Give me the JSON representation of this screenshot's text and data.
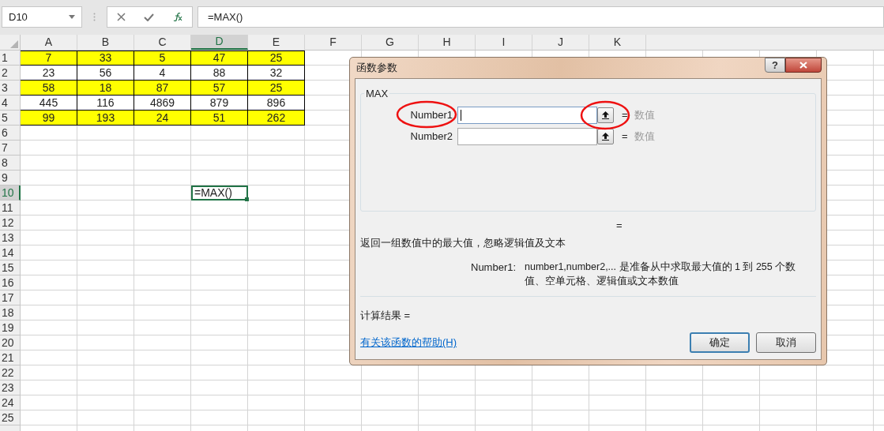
{
  "formula_bar": {
    "name_box": "D10",
    "formula": "=MAX()"
  },
  "sheet": {
    "columns": [
      {
        "label": "A",
        "selected": false
      },
      {
        "label": "B",
        "selected": false
      },
      {
        "label": "C",
        "selected": false
      },
      {
        "label": "D",
        "selected": true
      },
      {
        "label": "E",
        "selected": false
      },
      {
        "label": "F",
        "selected": false
      },
      {
        "label": "G",
        "selected": false
      },
      {
        "label": "H",
        "selected": false
      },
      {
        "label": "I",
        "selected": false
      },
      {
        "label": "J",
        "selected": false
      },
      {
        "label": "K",
        "selected": false
      }
    ],
    "rows": [
      {
        "label": "1",
        "selected": false,
        "highlighted": true,
        "cells": [
          {
            "text": "7",
            "selected": false
          },
          {
            "text": "33",
            "selected": false
          },
          {
            "text": "5",
            "selected": false
          },
          {
            "text": "47",
            "selected": false
          },
          {
            "text": "25",
            "selected": false
          }
        ]
      },
      {
        "label": "2",
        "selected": false,
        "highlighted": false,
        "cells": [
          {
            "text": "23",
            "selected": false
          },
          {
            "text": "56",
            "selected": false
          },
          {
            "text": "4",
            "selected": false
          },
          {
            "text": "88",
            "selected": false
          },
          {
            "text": "32",
            "selected": false
          }
        ]
      },
      {
        "label": "3",
        "selected": false,
        "highlighted": true,
        "cells": [
          {
            "text": "58",
            "selected": false
          },
          {
            "text": "18",
            "selected": false
          },
          {
            "text": "87",
            "selected": false
          },
          {
            "text": "57",
            "selected": false
          },
          {
            "text": "25",
            "selected": false
          }
        ]
      },
      {
        "label": "4",
        "selected": false,
        "highlighted": false,
        "cells": [
          {
            "text": "445",
            "selected": false
          },
          {
            "text": "116",
            "selected": false
          },
          {
            "text": "4869",
            "selected": false
          },
          {
            "text": "879",
            "selected": false
          },
          {
            "text": "896",
            "selected": false
          }
        ]
      },
      {
        "label": "5",
        "selected": false,
        "highlighted": true,
        "cells": [
          {
            "text": "99",
            "selected": false
          },
          {
            "text": "193",
            "selected": false
          },
          {
            "text": "24",
            "selected": false
          },
          {
            "text": "51",
            "selected": false
          },
          {
            "text": "262",
            "selected": false
          }
        ]
      },
      {
        "label": "6",
        "selected": false
      },
      {
        "label": "7",
        "selected": false
      },
      {
        "label": "8",
        "selected": false
      },
      {
        "label": "9",
        "selected": false
      },
      {
        "label": "10",
        "selected": true,
        "cells": [
          null,
          null,
          null,
          {
            "text": "=MAX()",
            "selected": true
          }
        ]
      },
      {
        "label": "11",
        "selected": false
      },
      {
        "label": "12",
        "selected": false
      },
      {
        "label": "13",
        "selected": false
      },
      {
        "label": "14",
        "selected": false
      },
      {
        "label": "15",
        "selected": false
      },
      {
        "label": "16",
        "selected": false
      },
      {
        "label": "17",
        "selected": false
      },
      {
        "label": "18",
        "selected": false
      },
      {
        "label": "19",
        "selected": false
      },
      {
        "label": "20",
        "selected": false
      },
      {
        "label": "21",
        "selected": false
      },
      {
        "label": "22",
        "selected": false
      },
      {
        "label": "23",
        "selected": false
      },
      {
        "label": "24",
        "selected": false
      },
      {
        "label": "25",
        "selected": false
      }
    ]
  },
  "dialog": {
    "title": "函数参数",
    "help_button": "?",
    "group_title": "MAX",
    "arguments": [
      {
        "label": "Number1",
        "focused": true,
        "equals": "=",
        "hint": "数值"
      },
      {
        "label": "Number2",
        "focused": false,
        "equals": "=",
        "hint": "数值"
      }
    ],
    "result_equals": "=",
    "description": "返回一组数值中的最大值，忽略逻辑值及文本",
    "argument_help": {
      "label": "Number1:",
      "text": "number1,number2,... 是准备从中求取最大值的 1 到 255 个数值、空单元格、逻辑值或文本数值"
    },
    "result_label": "计算结果 =",
    "help_link": "有关该函数的帮助(H)",
    "buttons": [
      {
        "label": "确定",
        "default": true
      },
      {
        "label": "取消",
        "default": false
      }
    ]
  }
}
